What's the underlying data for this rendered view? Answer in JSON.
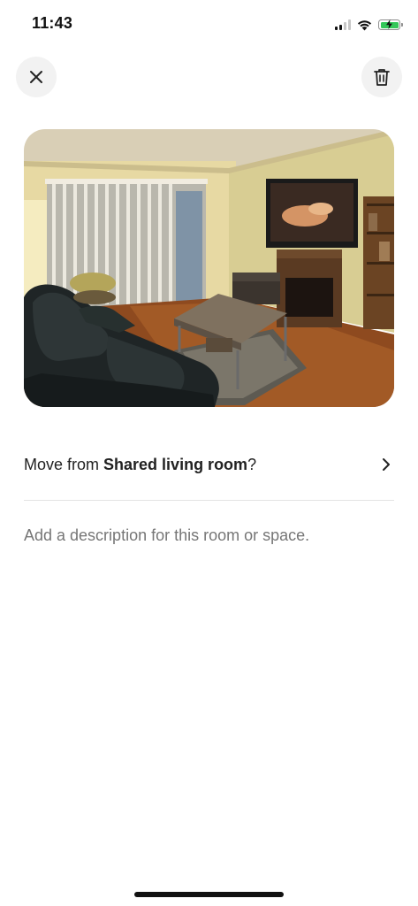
{
  "status_bar": {
    "time": "11:43",
    "icons": [
      "cellular-signal-icon",
      "wifi-icon",
      "battery-charging-icon"
    ],
    "battery_color": "#34c759"
  },
  "header": {
    "close_icon": "close-icon",
    "delete_icon": "trash-icon"
  },
  "photo": {
    "subject": "living room photo"
  },
  "move_row": {
    "prefix": "Move from ",
    "room": "Shared living room",
    "suffix": "?",
    "chevron_icon": "chevron-right-icon"
  },
  "description": {
    "placeholder": "Add a description for this room or space."
  },
  "colors": {
    "text": "#222222",
    "muted": "#767676",
    "button_bg": "#f2f2f2",
    "divider": "#e4e4e4"
  }
}
